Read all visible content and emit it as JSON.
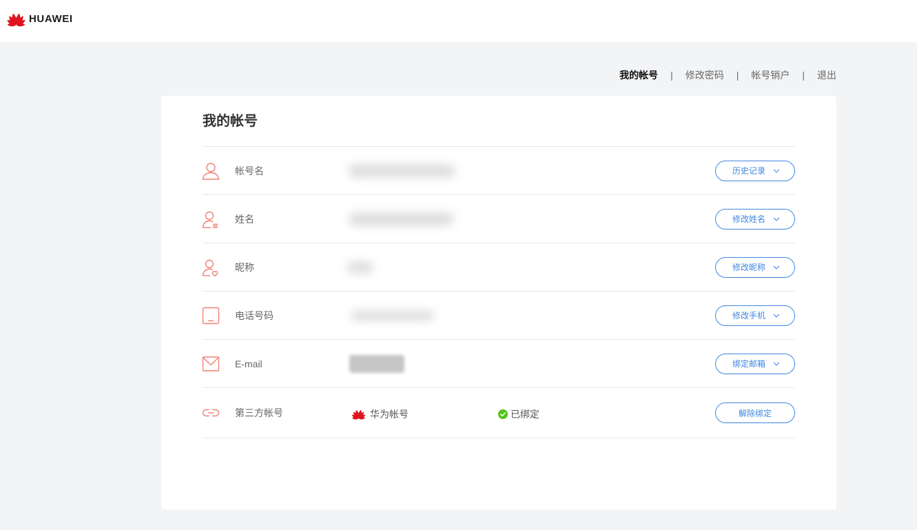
{
  "brand": {
    "name": "HUAWEI",
    "logo_icon": "huawei-flower-logo"
  },
  "nav": {
    "separator": "|",
    "items": [
      {
        "label": "我的帐号",
        "active": true
      },
      {
        "label": "修改密码",
        "active": false
      },
      {
        "label": "帐号销户",
        "active": false
      },
      {
        "label": "退出",
        "active": false
      }
    ]
  },
  "account": {
    "title": "我的帐号",
    "rows": [
      {
        "icon": "user-icon",
        "label": "帐号名",
        "action": "历史记录",
        "dropdown": true
      },
      {
        "icon": "user-list-icon",
        "label": "姓名",
        "action": "修改姓名",
        "dropdown": true
      },
      {
        "icon": "user-heart-icon",
        "label": "昵称",
        "action": "修改昵称",
        "dropdown": true
      },
      {
        "icon": "phone-icon",
        "label": "电话号码",
        "action": "修改手机",
        "dropdown": true
      },
      {
        "icon": "mail-icon",
        "label": "E-mail",
        "action": "绑定邮箱",
        "dropdown": true
      },
      {
        "icon": "link-icon",
        "label": "第三方帐号",
        "provider": {
          "name": "华为帐号",
          "icon": "huawei-flower-logo"
        },
        "status": {
          "text": "已绑定",
          "icon": "check-circle-icon"
        },
        "action": "解除绑定",
        "dropdown": false
      }
    ]
  },
  "colors": {
    "accent": "#3f86e0",
    "icon": "#ef7f73",
    "brand_red": "#e0141e",
    "success": "#52c41a",
    "page_bg": "#f3f4f6",
    "card_bg": "#ffffff",
    "label": "#666666",
    "title": "#333333"
  }
}
